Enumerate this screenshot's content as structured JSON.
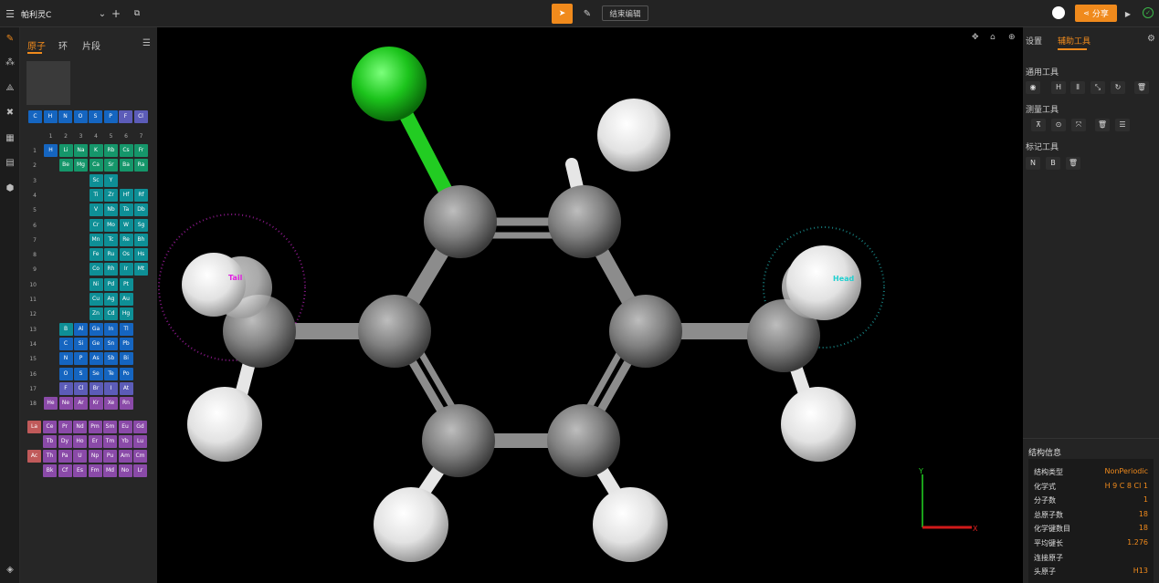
{
  "topbar": {
    "project_name": "帕利灵C",
    "end_edit_label": "结束编辑",
    "share_label": "分享"
  },
  "left_panel": {
    "tabs": [
      "原子",
      "环",
      "片段"
    ],
    "common_elements": [
      {
        "symbol": "C",
        "color": "#1565c0"
      },
      {
        "symbol": "H",
        "color": "#1565c0"
      },
      {
        "symbol": "N",
        "color": "#1565c0"
      },
      {
        "symbol": "O",
        "color": "#1565c0"
      },
      {
        "symbol": "S",
        "color": "#1565c0"
      },
      {
        "symbol": "P",
        "color": "#1565c0"
      },
      {
        "symbol": "F",
        "color": "#5c5cb8"
      },
      {
        "symbol": "Cl",
        "color": "#5c5cb8"
      }
    ],
    "column_labels": [
      "1",
      "2",
      "3",
      "4",
      "5",
      "6",
      "7"
    ],
    "rows": [
      {
        "label": "1",
        "cells": [
          [
            0,
            "H",
            "#1565c0"
          ],
          [
            1,
            "Li",
            "#15966a"
          ],
          [
            2,
            "Na",
            "#15966a"
          ],
          [
            3,
            "K",
            "#15966a"
          ],
          [
            4,
            "Rb",
            "#15966a"
          ],
          [
            5,
            "Cs",
            "#15966a"
          ],
          [
            6,
            "Fr",
            "#15966a"
          ]
        ]
      },
      {
        "label": "2",
        "cells": [
          [
            1,
            "Be",
            "#15966a"
          ],
          [
            2,
            "Mg",
            "#15966a"
          ],
          [
            3,
            "Ca",
            "#15966a"
          ],
          [
            4,
            "Sr",
            "#15966a"
          ],
          [
            5,
            "Ba",
            "#15966a"
          ],
          [
            6,
            "Ra",
            "#15966a"
          ]
        ]
      },
      {
        "label": "3",
        "cells": [
          [
            3,
            "Sc",
            "#0e8f96"
          ],
          [
            4,
            "Y",
            "#0e8f96"
          ]
        ]
      },
      {
        "label": "4",
        "cells": [
          [
            3,
            "Ti",
            "#0e8f96"
          ],
          [
            4,
            "Zr",
            "#0e8f96"
          ],
          [
            5,
            "Hf",
            "#0e8f96"
          ],
          [
            6,
            "Rf",
            "#0e8f96"
          ]
        ]
      },
      {
        "label": "5",
        "cells": [
          [
            3,
            "V",
            "#0e8f96"
          ],
          [
            4,
            "Nb",
            "#0e8f96"
          ],
          [
            5,
            "Ta",
            "#0e8f96"
          ],
          [
            6,
            "Db",
            "#0e8f96"
          ]
        ]
      },
      {
        "label": "6",
        "cells": [
          [
            3,
            "Cr",
            "#0e8f96"
          ],
          [
            4,
            "Mo",
            "#0e8f96"
          ],
          [
            5,
            "W",
            "#0e8f96"
          ],
          [
            6,
            "Sg",
            "#0e8f96"
          ]
        ]
      },
      {
        "label": "7",
        "cells": [
          [
            3,
            "Mn",
            "#0e8f96"
          ],
          [
            4,
            "Tc",
            "#0e8f96"
          ],
          [
            5,
            "Re",
            "#0e8f96"
          ],
          [
            6,
            "Bh",
            "#0e8f96"
          ]
        ]
      },
      {
        "label": "8",
        "cells": [
          [
            3,
            "Fe",
            "#0e8f96"
          ],
          [
            4,
            "Ru",
            "#0e8f96"
          ],
          [
            5,
            "Os",
            "#0e8f96"
          ],
          [
            6,
            "Hs",
            "#0e8f96"
          ]
        ]
      },
      {
        "label": "9",
        "cells": [
          [
            3,
            "Co",
            "#0e8f96"
          ],
          [
            4,
            "Rh",
            "#0e8f96"
          ],
          [
            5,
            "Ir",
            "#0e8f96"
          ],
          [
            6,
            "Mt",
            "#0e8f96"
          ]
        ]
      },
      {
        "label": "10",
        "cells": [
          [
            3,
            "Ni",
            "#0e8f96"
          ],
          [
            4,
            "Pd",
            "#0e8f96"
          ],
          [
            5,
            "Pt",
            "#0e8f96"
          ]
        ]
      },
      {
        "label": "11",
        "cells": [
          [
            3,
            "Cu",
            "#0e8f96"
          ],
          [
            4,
            "Ag",
            "#0e8f96"
          ],
          [
            5,
            "Au",
            "#0e8f96"
          ]
        ]
      },
      {
        "label": "12",
        "cells": [
          [
            3,
            "Zn",
            "#0e8f96"
          ],
          [
            4,
            "Cd",
            "#0e8f96"
          ],
          [
            5,
            "Hg",
            "#0e8f96"
          ]
        ]
      },
      {
        "label": "13",
        "cells": [
          [
            1,
            "B",
            "#0e8f96"
          ],
          [
            2,
            "Al",
            "#1565c0"
          ],
          [
            3,
            "Ga",
            "#1565c0"
          ],
          [
            4,
            "In",
            "#1565c0"
          ],
          [
            5,
            "Tl",
            "#1565c0"
          ]
        ]
      },
      {
        "label": "14",
        "cells": [
          [
            1,
            "C",
            "#1565c0"
          ],
          [
            2,
            "Si",
            "#1565c0"
          ],
          [
            3,
            "Ge",
            "#1565c0"
          ],
          [
            4,
            "Sn",
            "#1565c0"
          ],
          [
            5,
            "Pb",
            "#1565c0"
          ]
        ]
      },
      {
        "label": "15",
        "cells": [
          [
            1,
            "N",
            "#1565c0"
          ],
          [
            2,
            "P",
            "#1565c0"
          ],
          [
            3,
            "As",
            "#1565c0"
          ],
          [
            4,
            "Sb",
            "#1565c0"
          ],
          [
            5,
            "Bi",
            "#1565c0"
          ]
        ]
      },
      {
        "label": "16",
        "cells": [
          [
            1,
            "O",
            "#1565c0"
          ],
          [
            2,
            "S",
            "#1565c0"
          ],
          [
            3,
            "Se",
            "#1565c0"
          ],
          [
            4,
            "Te",
            "#1565c0"
          ],
          [
            5,
            "Po",
            "#1565c0"
          ]
        ]
      },
      {
        "label": "17",
        "cells": [
          [
            1,
            "F",
            "#5c5cb8"
          ],
          [
            2,
            "Cl",
            "#5c5cb8"
          ],
          [
            3,
            "Br",
            "#5c5cb8"
          ],
          [
            4,
            "I",
            "#5c5cb8"
          ],
          [
            5,
            "At",
            "#5c5cb8"
          ]
        ]
      },
      {
        "label": "18",
        "cells": [
          [
            0,
            "He",
            "#8a4aa8"
          ],
          [
            1,
            "Ne",
            "#8a4aa8"
          ],
          [
            2,
            "Ar",
            "#8a4aa8"
          ],
          [
            3,
            "Kr",
            "#8a4aa8"
          ],
          [
            4,
            "Xe",
            "#8a4aa8"
          ],
          [
            5,
            "Rn",
            "#8a4aa8"
          ]
        ]
      }
    ],
    "lanthanides": [
      [
        "La",
        "#c05a5a"
      ],
      [
        "Ce",
        "#8a4aa8"
      ],
      [
        "Pr",
        "#8a4aa8"
      ],
      [
        "Nd",
        "#8a4aa8"
      ],
      [
        "Pm",
        "#8a4aa8"
      ],
      [
        "Sm",
        "#8a4aa8"
      ],
      [
        "Eu",
        "#8a4aa8"
      ],
      [
        "Gd",
        "#8a4aa8"
      ]
    ],
    "lanthanides2": [
      [
        "Tb",
        "#8a4aa8"
      ],
      [
        "Dy",
        "#8a4aa8"
      ],
      [
        "Ho",
        "#8a4aa8"
      ],
      [
        "Er",
        "#8a4aa8"
      ],
      [
        "Tm",
        "#8a4aa8"
      ],
      [
        "Yb",
        "#8a4aa8"
      ],
      [
        "Lu",
        "#8a4aa8"
      ]
    ],
    "actinides": [
      [
        "Ac",
        "#c05a5a"
      ],
      [
        "Th",
        "#8a4aa8"
      ],
      [
        "Pa",
        "#8a4aa8"
      ],
      [
        "U",
        "#8a4aa8"
      ],
      [
        "Np",
        "#8a4aa8"
      ],
      [
        "Pu",
        "#8a4aa8"
      ],
      [
        "Am",
        "#8a4aa8"
      ],
      [
        "Cm",
        "#8a4aa8"
      ]
    ],
    "actinides2": [
      [
        "Bk",
        "#8a4aa8"
      ],
      [
        "Cf",
        "#8a4aa8"
      ],
      [
        "Es",
        "#8a4aa8"
      ],
      [
        "Fm",
        "#8a4aa8"
      ],
      [
        "Md",
        "#8a4aa8"
      ],
      [
        "No",
        "#8a4aa8"
      ],
      [
        "Lr",
        "#8a4aa8"
      ]
    ]
  },
  "viewport": {
    "tail_label": "Tail",
    "head_label": "Head",
    "axis_x": "X",
    "axis_y": "Y"
  },
  "right_panel": {
    "tab_settings": "设置",
    "tab_tools": "辅助工具",
    "general_tools_title": "通用工具",
    "measure_tools_title": "测量工具",
    "mark_tools_title": "标记工具",
    "structure_info_title": "结构信息",
    "info": [
      {
        "key": "结构类型",
        "value": "NonPeriodic"
      },
      {
        "key": "化学式",
        "value": "H 9 C 8 Cl 1"
      },
      {
        "key": "分子数",
        "value": "1"
      },
      {
        "key": "总原子数",
        "value": "18"
      },
      {
        "key": "化学键数目",
        "value": "18"
      },
      {
        "key": "平均键长",
        "value": "1.276"
      },
      {
        "key": "连接原子",
        "value": ""
      },
      {
        "key": "头原子",
        "value": "H13"
      }
    ]
  },
  "colors": {
    "accent": "#f08a1c",
    "background": "#000000"
  }
}
